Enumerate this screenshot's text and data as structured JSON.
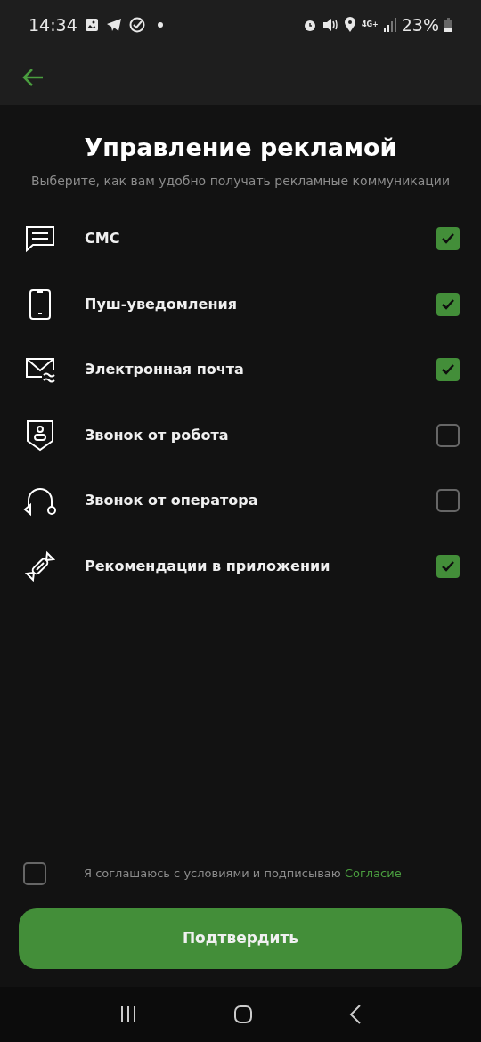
{
  "status_bar": {
    "time": "14:34",
    "network": "4G+",
    "battery": "23%"
  },
  "title": "Управление рекламой",
  "subtitle": "Выберите, как вам удобно получать рекламные коммуникации",
  "channels": [
    {
      "label": "СМС",
      "checked": true
    },
    {
      "label": "Пуш-уведомления",
      "checked": true
    },
    {
      "label": "Электронная почта",
      "checked": true
    },
    {
      "label": "Звонок от робота",
      "checked": false
    },
    {
      "label": "Звонок от оператора",
      "checked": false
    },
    {
      "label": "Рекомендации в приложении",
      "checked": true
    }
  ],
  "consent": {
    "text": "Я соглашаюсь с условиями и подписываю",
    "link": "Согласие",
    "checked": false
  },
  "confirm_button": "Подтвердить"
}
